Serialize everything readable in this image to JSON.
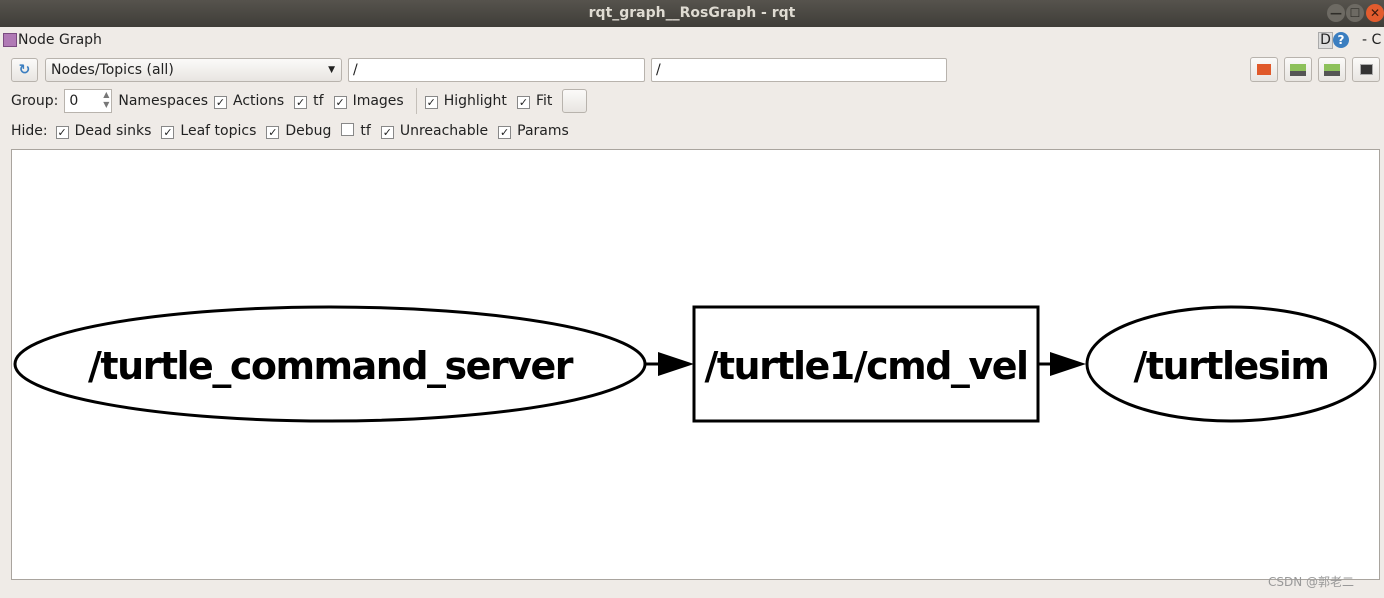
{
  "window": {
    "title": "rqt_graph__RosGraph - rqt",
    "minimize": "—",
    "maximize": "☐",
    "close": "✕"
  },
  "plugin": {
    "title": "Node Graph",
    "d_label": "D",
    "help": "?",
    "extra": "- C"
  },
  "toolbar": {
    "mode": "Nodes/Topics (all)",
    "filter1": "/",
    "filter2": "/"
  },
  "options": {
    "group_label": "Group:",
    "group_value": "0",
    "namespaces": "Namespaces",
    "items": [
      {
        "label": "Actions",
        "checked": true
      },
      {
        "label": "tf",
        "checked": true
      },
      {
        "label": "Images",
        "checked": true
      }
    ],
    "items2": [
      {
        "label": "Highlight",
        "checked": true
      },
      {
        "label": "Fit",
        "checked": true
      }
    ]
  },
  "hide": {
    "label": "Hide:",
    "items": [
      {
        "label": "Dead sinks",
        "checked": true
      },
      {
        "label": "Leaf topics",
        "checked": true
      },
      {
        "label": "Debug",
        "checked": true
      },
      {
        "label": "tf",
        "checked": false
      },
      {
        "label": "Unreachable",
        "checked": true
      },
      {
        "label": "Params",
        "checked": true
      }
    ]
  },
  "graph": {
    "nodes": [
      {
        "label": "/turtle_command_server",
        "shape": "ellipse"
      },
      {
        "label": "/turtle1/cmd_vel",
        "shape": "box"
      },
      {
        "label": "/turtlesim",
        "shape": "ellipse"
      }
    ]
  },
  "watermark": "CSDN @郭老二"
}
